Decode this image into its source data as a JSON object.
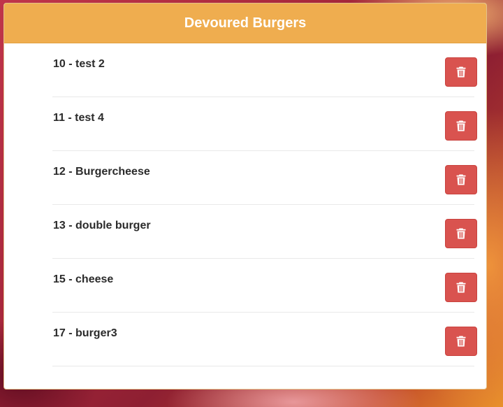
{
  "panel": {
    "title": "Devoured Burgers"
  },
  "items": [
    {
      "label": "10 - test 2",
      "button_icon": "trash-icon"
    },
    {
      "label": "11 - test 4",
      "button_icon": "trash-icon"
    },
    {
      "label": "12 - Burgercheese",
      "button_icon": "trash-icon"
    },
    {
      "label": "13 - double burger",
      "button_icon": "trash-icon"
    },
    {
      "label": "15 - cheese",
      "button_icon": "trash-icon"
    },
    {
      "label": "17 - burger3",
      "button_icon": "trash-icon"
    }
  ],
  "colors": {
    "heading_bg": "#efad4f",
    "delete_button": "#d9534f",
    "text": "#2b2b2b"
  }
}
